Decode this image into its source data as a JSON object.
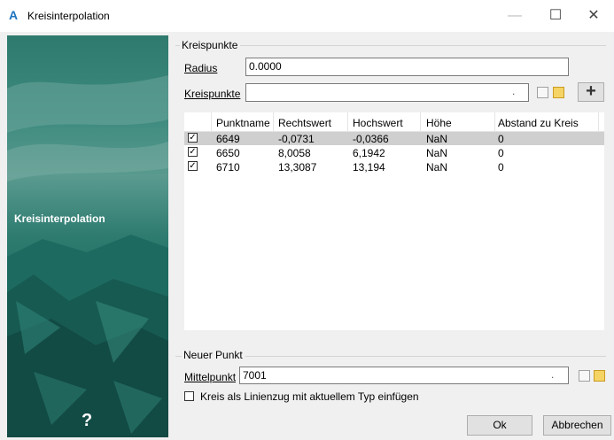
{
  "window": {
    "title": "Kreisinterpolation",
    "app_icon": "A",
    "minimize_glyph": "—",
    "maximize_glyph": "☐",
    "close_glyph": "✕"
  },
  "sidebar": {
    "title": "Kreisinterpolation",
    "help_glyph": "?"
  },
  "kreispunkte": {
    "group_label": "Kreispunkte",
    "radius_label": "Radius",
    "radius_value": "0.0000",
    "points_label": "Kreispunkte",
    "points_value": "",
    "dropdown_glyph": ".",
    "add_glyph": "+"
  },
  "table": {
    "columns": [
      "Punktname",
      "Rechtswert",
      "Hochswert",
      "Höhe",
      "Abstand zu Kreis"
    ],
    "check_glyph": "✓",
    "rows": [
      {
        "checked": true,
        "cells": [
          "6649",
          "-0,0731",
          "-0,0366",
          "NaN",
          "0"
        ]
      },
      {
        "checked": true,
        "cells": [
          "6650",
          "8,0058",
          "6,1942",
          "NaN",
          "0"
        ]
      },
      {
        "checked": true,
        "cells": [
          "6710",
          "13,3087",
          "13,194",
          "NaN",
          "0"
        ]
      }
    ]
  },
  "neuer_punkt": {
    "group_label": "Neuer Punkt",
    "mittelpunkt_label": "Mittelpunkt",
    "mittelpunkt_value": "7001",
    "dropdown_glyph": ".",
    "checkbox_label": "Kreis als Linienzug mit aktuellem Typ einfügen",
    "checkbox_checked": false
  },
  "buttons": {
    "ok": "Ok",
    "cancel": "Abbrechen"
  },
  "colors": {
    "selected_row": "#cfcfcf",
    "accent": "#1e73be",
    "sidebar_teal": "#2e7b70"
  }
}
